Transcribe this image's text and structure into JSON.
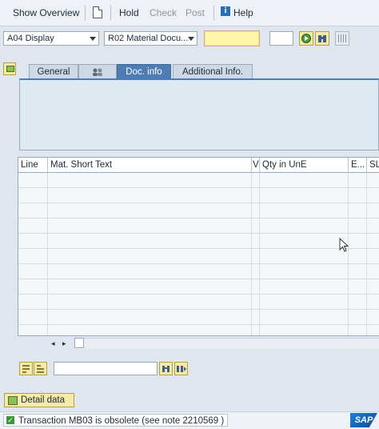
{
  "toolbar": {
    "show_overview": "Show Overview",
    "hold": "Hold",
    "check": "Check",
    "post": "Post",
    "help": "Help",
    "help_icon": "i"
  },
  "header": {
    "action_dropdown": "A04 Display",
    "ref_dropdown": "R02 Material Docu...",
    "document_number": "",
    "year": ""
  },
  "tabs": [
    {
      "label": "General"
    },
    {
      "label": "",
      "icon": "partner-icon"
    },
    {
      "label": "Doc. info"
    },
    {
      "label": "Additional Info."
    }
  ],
  "grid": {
    "columns": [
      "Line",
      "Mat. Short Text",
      "V",
      "Qty in UnE",
      "E...",
      "SL"
    ],
    "rows": [
      [],
      [],
      [],
      [],
      [],
      [],
      [],
      [],
      [],
      []
    ]
  },
  "bottom": {
    "find_value": "",
    "detail_button": "Detail data"
  },
  "status": {
    "message": "Transaction MB03 is obsolete (see note 2210569 )",
    "ok_glyph": "✓"
  },
  "brand": {
    "logo": "SAP"
  }
}
